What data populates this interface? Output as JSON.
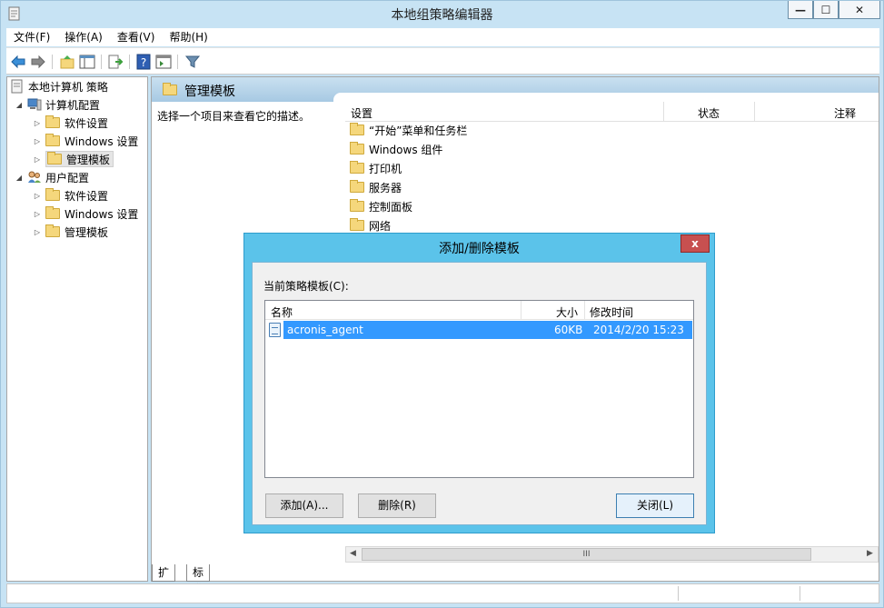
{
  "window": {
    "title": "本地组策略编辑器",
    "min_glyph": "—",
    "max_glyph": "☐",
    "close_glyph": "✕"
  },
  "menu": [
    "文件(F)",
    "操作(A)",
    "查看(V)",
    "帮助(H)"
  ],
  "tree": {
    "root": "本地计算机 策略",
    "computer": "计算机配置",
    "computer_children": [
      "软件设置",
      "Windows 设置",
      "管理模板"
    ],
    "user": "用户配置",
    "user_children": [
      "软件设置",
      "Windows 设置",
      "管理模板"
    ]
  },
  "right": {
    "header": "管理模板",
    "description": "选择一个项目来查看它的描述。",
    "columns": [
      "设置",
      "状态",
      "注释"
    ],
    "items": [
      "“开始”菜单和任务栏",
      "Windows 组件",
      "打印机",
      "服务器",
      "控制面板",
      "网络"
    ],
    "scroll_glyph": "III"
  },
  "tabs": [
    "扩展",
    "标准"
  ],
  "dialog": {
    "title": "添加/删除模板",
    "close_glyph": "x",
    "label": "当前策略模板(C):",
    "columns": [
      "名称",
      "大小",
      "修改时间"
    ],
    "rows": [
      {
        "name": "acronis_agent",
        "size": "60KB",
        "modified": "2014/2/20 15:23"
      }
    ],
    "buttons": {
      "add": "添加(A)...",
      "remove": "删除(R)",
      "close": "关闭(L)"
    }
  },
  "colors": {
    "titlebar": "#c7e3f4",
    "dialog_frame": "#5bc3ea",
    "selection": "#3399ff",
    "close_red": "#c75050"
  }
}
